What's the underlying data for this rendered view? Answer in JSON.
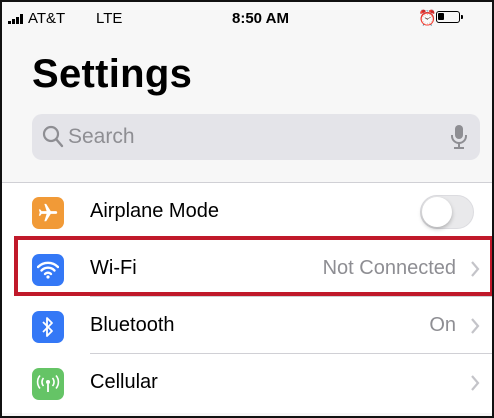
{
  "status_bar": {
    "carrier": "AT&T",
    "network": "LTE",
    "time": "8:50 AM",
    "icons": [
      "signal-bars-icon",
      "alarm-icon",
      "battery-icon"
    ]
  },
  "page_title": "Settings",
  "search": {
    "placeholder": "Search"
  },
  "settings_rows": [
    {
      "label": "Airplane Mode",
      "icon": "airplane-icon",
      "icon_color": "#f19a37",
      "control": "toggle",
      "toggle_on": false
    },
    {
      "label": "Wi-Fi",
      "value": "Not Connected",
      "icon": "wifi-icon",
      "icon_color": "#3478f6",
      "highlighted": true
    },
    {
      "label": "Bluetooth",
      "value": "On",
      "icon": "bluetooth-icon",
      "icon_color": "#3478f6"
    },
    {
      "label": "Cellular",
      "icon": "cellular-icon",
      "icon_color": "#65c466"
    }
  ],
  "colors": {
    "highlight_border": "#c0192a",
    "secondary_text": "#8e8e93",
    "background": "#f7f7f7"
  }
}
